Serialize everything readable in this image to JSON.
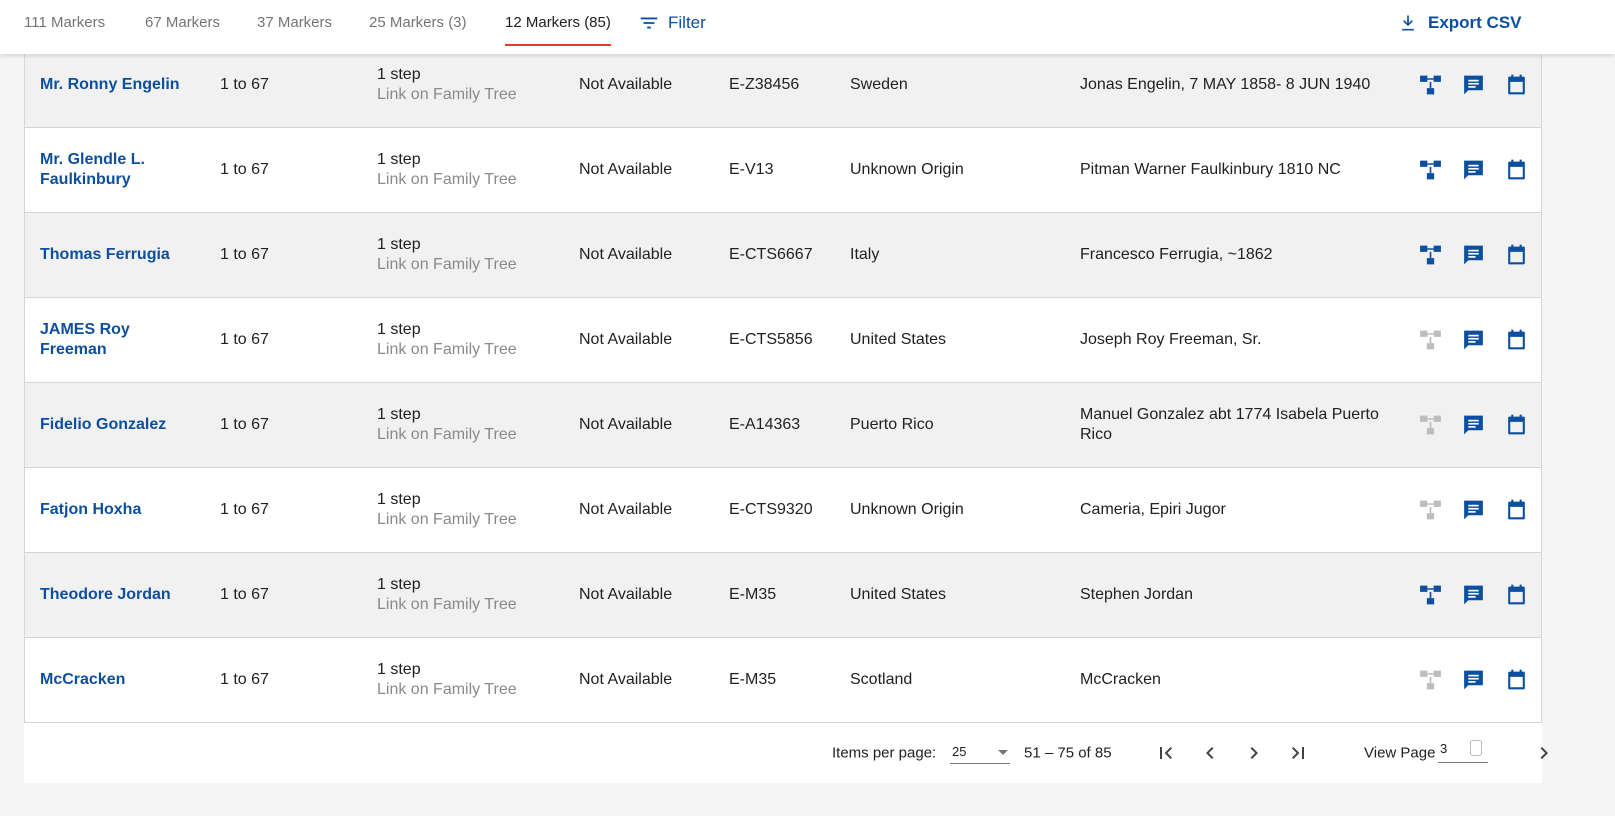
{
  "tabs": [
    {
      "label": "111 Markers",
      "active": false
    },
    {
      "label": "67 Markers",
      "active": false
    },
    {
      "label": "37 Markers",
      "active": false
    },
    {
      "label": "25 Markers (3)",
      "active": false
    },
    {
      "label": "12 Markers (85)",
      "active": true
    }
  ],
  "toolbar": {
    "filter_label": "Filter",
    "export_label": "Export CSV",
    "filter_icon": "filter-icon",
    "export_icon": "download-icon"
  },
  "colors": {
    "link": "#0d4f9e",
    "icon_active": "#0d4f9e",
    "icon_inactive": "#bdbdbd",
    "tab_indicator": "#e53935",
    "row_shade": "#f1f1f1"
  },
  "rows": [
    {
      "name": "Mr. Ronny Engelin",
      "range": "1 to 67",
      "step": "1 step",
      "step_link": "Link on Family Tree",
      "availability": "Not Available",
      "kit": "E-Z38456",
      "origin": "Sweden",
      "ancestor": "Jonas Engelin, 7 MAY 1858- 8 JUN 1940",
      "tree_active": true
    },
    {
      "name": "Mr. Glendle L. Faulkinbury",
      "range": "1 to 67",
      "step": "1 step",
      "step_link": "Link on Family Tree",
      "availability": "Not Available",
      "kit": "E-V13",
      "origin": "Unknown Origin",
      "ancestor": "Pitman Warner Faulkinbury 1810 NC",
      "tree_active": true
    },
    {
      "name": "Thomas Ferrugia",
      "range": "1 to 67",
      "step": "1 step",
      "step_link": "Link on Family Tree",
      "availability": "Not Available",
      "kit": "E-CTS6667",
      "origin": "Italy",
      "ancestor": "Francesco Ferrugia, ~1862",
      "tree_active": true
    },
    {
      "name": "JAMES Roy Freeman",
      "range": "1 to 67",
      "step": "1 step",
      "step_link": "Link on Family Tree",
      "availability": "Not Available",
      "kit": "E-CTS5856",
      "origin": "United States",
      "ancestor": "Joseph Roy Freeman, Sr.",
      "tree_active": false
    },
    {
      "name": "Fidelio Gonzalez",
      "range": "1 to 67",
      "step": "1 step",
      "step_link": "Link on Family Tree",
      "availability": "Not Available",
      "kit": "E-A14363",
      "origin": "Puerto Rico",
      "ancestor": "Manuel Gonzalez abt 1774 Isabela Puerto Rico",
      "tree_active": false
    },
    {
      "name": "Fatjon Hoxha",
      "range": "1 to 67",
      "step": "1 step",
      "step_link": "Link on Family Tree",
      "availability": "Not Available",
      "kit": "E-CTS9320",
      "origin": "Unknown Origin",
      "ancestor": "Cameria, Epiri Jugor",
      "tree_active": false
    },
    {
      "name": "Theodore Jordan",
      "range": "1 to 67",
      "step": "1 step",
      "step_link": "Link on Family Tree",
      "availability": "Not Available",
      "kit": "E-M35",
      "origin": "United States",
      "ancestor": "Stephen Jordan",
      "tree_active": true
    },
    {
      "name": "McCracken",
      "range": "1 to 67",
      "step": "1 step",
      "step_link": "Link on Family Tree",
      "availability": "Not Available",
      "kit": "E-M35",
      "origin": "Scotland",
      "ancestor": "McCracken",
      "tree_active": false
    }
  ],
  "pager": {
    "items_per_page_label": "Items per page:",
    "items_per_page_value": "25",
    "range_label": "51 – 75 of 85",
    "view_page_label": "View Page",
    "view_page_value": "3"
  }
}
